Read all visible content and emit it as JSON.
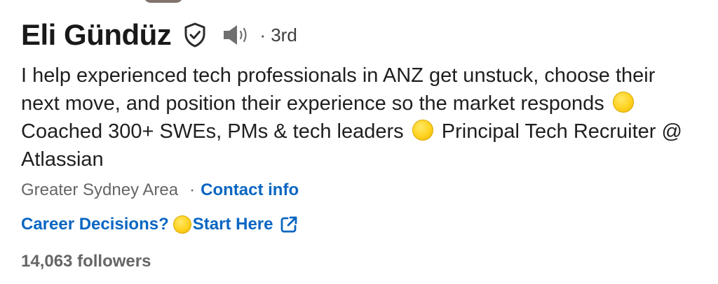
{
  "profile": {
    "name": "Eli Gündüz",
    "degree": "· 3rd",
    "headline": {
      "part1": "I help experienced tech professionals in ANZ get unstuck, choose their next move, and position their experience so the market responds",
      "part2": "Coached 300+ SWEs, PMs & tech leaders",
      "part3": "Principal Tech Recruiter @ Atlassian"
    },
    "location": "Greater Sydney Area",
    "separator": "·",
    "contact_info": "Contact info",
    "website": {
      "label_before": "Career Decisions?",
      "label_after": "Start Here"
    },
    "followers": "14,063 followers"
  },
  "icons": {
    "verified": "verified-shield-icon",
    "pronunciation": "speaker-icon",
    "external_link": "external-link-icon",
    "emoji": "yellow-circle-emoji"
  },
  "colors": {
    "link": "#0a66c2",
    "muted": "#666666",
    "text": "#1f1f1f",
    "emoji": "#ffd21f"
  }
}
